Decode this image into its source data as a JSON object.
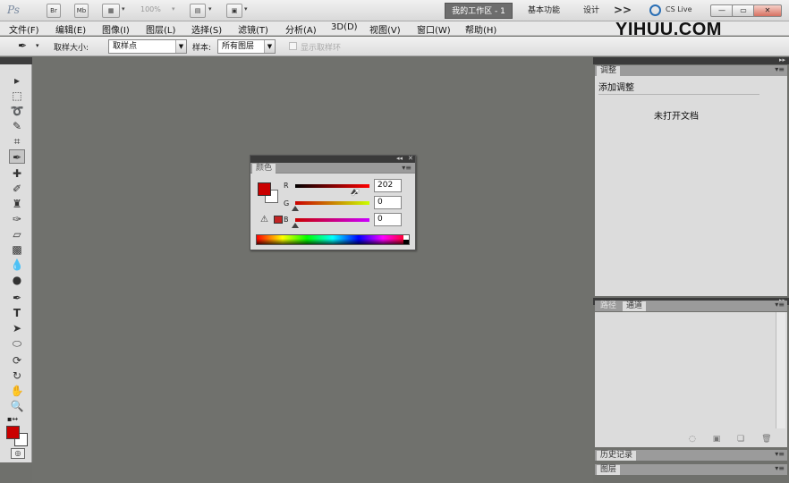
{
  "app_bar": {
    "logo": "Ps",
    "br_button": "Br",
    "mb_button": "Mb",
    "zoom": "100%",
    "workspaces": [
      "我的工作区 - 1",
      "基本功能",
      "设计"
    ],
    "more": ">>",
    "cs_live": "CS Live",
    "window_controls": [
      "—",
      "▭",
      "✕"
    ]
  },
  "menu": {
    "items": [
      "文件(F)",
      "编辑(E)",
      "图像(I)",
      "图层(L)",
      "选择(S)",
      "滤镜(T)",
      "分析(A)",
      "3D(D)",
      "视图(V)",
      "窗口(W)",
      "帮助(H)"
    ]
  },
  "watermark": "YIHUU.COM",
  "options_bar": {
    "sample_size_label": "取样大小:",
    "sample_size_value": "取样点",
    "sample_label": "样本:",
    "sample_value": "所有图层",
    "show_ring_label": "显示取样环"
  },
  "tools": {
    "icons": [
      "move-icon",
      "rect-marquee-icon",
      "lasso-icon",
      "quick-select-icon",
      "crop-icon",
      "eyedropper-icon",
      "healing-brush-icon",
      "brush-icon",
      "clone-stamp-icon",
      "history-brush-icon",
      "eraser-icon",
      "gradient-icon",
      "blur-icon",
      "dodge-icon",
      "pen-icon",
      "type-icon",
      "path-select-icon",
      "ellipse-shape-icon",
      "3d-rotate-icon",
      "3d-orbit-icon",
      "hand-icon",
      "zoom-icon"
    ],
    "foreground_color": "#ca0000",
    "background_color": "#ffffff"
  },
  "color_panel": {
    "tab": "颜色",
    "foreground": "#ca0000",
    "r_label": "R",
    "g_label": "G",
    "b_label": "B",
    "r_value": "202",
    "g_value": "0",
    "b_value": "0",
    "r_level": 202,
    "g_level": 0,
    "b_level": 0
  },
  "adjust_panel": {
    "tab": "调整",
    "title": "添加调整",
    "empty_text": "未打开文档"
  },
  "paths_panel": {
    "tabs": [
      "路径",
      "通道"
    ]
  },
  "history_panel": {
    "tab": "历史记录"
  },
  "layers_panel": {
    "tab": "图层"
  }
}
